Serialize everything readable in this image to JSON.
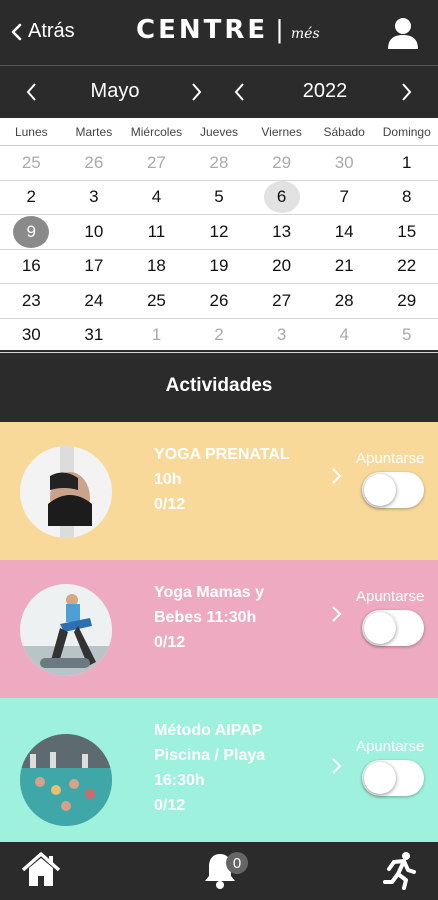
{
  "header": {
    "back_label": "Atrás",
    "logo_main": "CENTRE",
    "logo_sub": "més"
  },
  "selector": {
    "month": "Mayo",
    "year": "2022"
  },
  "calendar": {
    "day_names": [
      "Lunes",
      "Martes",
      "Miércoles",
      "Jueves",
      "Viernes",
      "Sábado",
      "Domingo"
    ],
    "weeks": [
      [
        {
          "d": "25",
          "m": true
        },
        {
          "d": "26",
          "m": true
        },
        {
          "d": "27",
          "m": true
        },
        {
          "d": "28",
          "m": true
        },
        {
          "d": "29",
          "m": true
        },
        {
          "d": "30",
          "m": true
        },
        {
          "d": "1"
        }
      ],
      [
        {
          "d": "2"
        },
        {
          "d": "3"
        },
        {
          "d": "4"
        },
        {
          "d": "5"
        },
        {
          "d": "6",
          "hl": true
        },
        {
          "d": "7"
        },
        {
          "d": "8"
        }
      ],
      [
        {
          "d": "9",
          "sel": true
        },
        {
          "d": "10"
        },
        {
          "d": "11"
        },
        {
          "d": "12"
        },
        {
          "d": "13"
        },
        {
          "d": "14"
        },
        {
          "d": "15"
        }
      ],
      [
        {
          "d": "16"
        },
        {
          "d": "17"
        },
        {
          "d": "18"
        },
        {
          "d": "19"
        },
        {
          "d": "20"
        },
        {
          "d": "21"
        },
        {
          "d": "22"
        }
      ],
      [
        {
          "d": "23"
        },
        {
          "d": "24"
        },
        {
          "d": "25"
        },
        {
          "d": "26"
        },
        {
          "d": "27"
        },
        {
          "d": "28"
        },
        {
          "d": "29"
        }
      ],
      [
        {
          "d": "30"
        },
        {
          "d": "31"
        },
        {
          "d": "1",
          "m": true
        },
        {
          "d": "2",
          "m": true
        },
        {
          "d": "3",
          "m": true
        },
        {
          "d": "4",
          "m": true
        },
        {
          "d": "5",
          "m": true
        }
      ]
    ]
  },
  "activities": {
    "title": "Actividades",
    "items": [
      {
        "lines": [
          "YOGA PRENATAL",
          "10h",
          "0/12"
        ],
        "action": "Apuntarse",
        "color": "#f8d99a",
        "enrolled": false
      },
      {
        "lines": [
          "Yoga Mamas y",
          "Bebes 11:30h",
          "0/12"
        ],
        "action": "Apuntarse",
        "color": "#eeaac0",
        "enrolled": false
      },
      {
        "lines": [
          "Método AIPAP",
          "Piscina / Playa",
          "16:30h",
          "0/12"
        ],
        "action": "Apuntarse",
        "color": "#9ef2dd",
        "enrolled": false
      }
    ]
  },
  "bottom_nav": {
    "notifications_count": "0"
  }
}
